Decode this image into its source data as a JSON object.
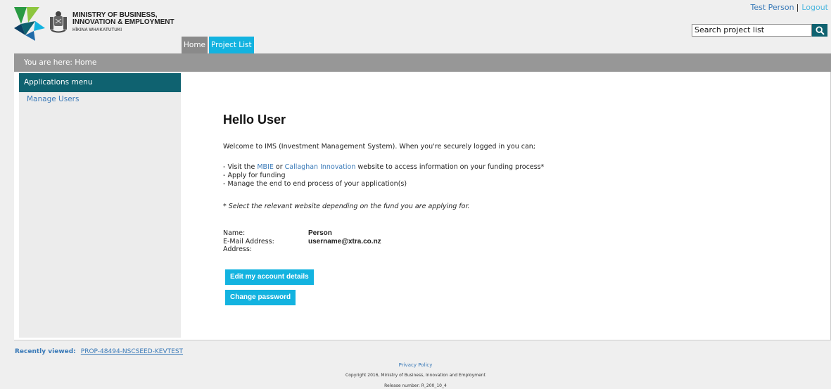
{
  "header": {
    "org_line1": "MINISTRY OF BUSINESS,",
    "org_line2": "INNOVATION & EMPLOYMENT",
    "org_sub": "HĪKINA WHAKATUTUKI",
    "user_name": "Test Person",
    "separator": "|",
    "logout_label": "Logout",
    "search_placeholder": "Search project list"
  },
  "tabs": [
    {
      "label": "Home"
    },
    {
      "label": "Project List"
    }
  ],
  "breadcrumb": "You are here: Home",
  "sidebar": {
    "title": "Applications menu",
    "items": [
      {
        "label": "Manage Users"
      }
    ]
  },
  "main": {
    "greeting": "Hello User",
    "welcome": "Welcome to IMS (Investment Management System). When you're securely logged in you can;",
    "list": {
      "visit_prefix": "- Visit the ",
      "mbie_link": "MBIE",
      "or": " or ",
      "callaghan_link": "Callaghan Innovation",
      "visit_suffix": " website to access information on your funding process*",
      "apply": "- Apply for funding",
      "manage": "- Manage the end to end process of your application(s)"
    },
    "note": "* Select the relevant website depending on the fund you are applying for.",
    "details": {
      "name_label": "Name:",
      "name_value": "Person",
      "email_label": "E-Mail Address:",
      "email_value": "username@xtra.co.nz",
      "address_label": "Address:",
      "address_value": ""
    },
    "edit_button": "Edit my account details",
    "password_button": "Change password"
  },
  "footer": {
    "recent_label": "Recently viewed:",
    "recent_link": "PROP-48494-NSCSEED-KEVTEST",
    "privacy": "Privacy Policy",
    "copyright": "Copyright 2016, Ministry of Business, Innovation and Employment",
    "release": "Release number: R_200_10_4"
  },
  "colors": {
    "brand_teal": "#0f6270",
    "accent_blue": "#13b3e0",
    "breadcrumb_grey": "#979797",
    "link_blue": "#3a7ab8"
  }
}
